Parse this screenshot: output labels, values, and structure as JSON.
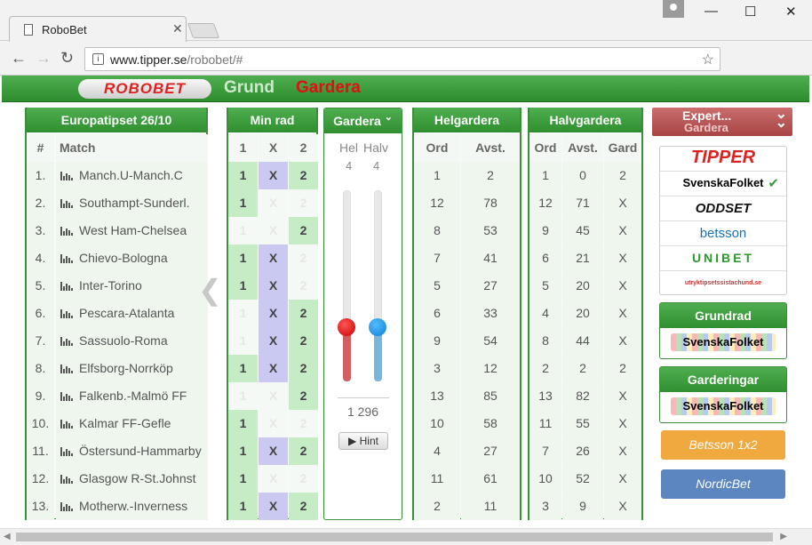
{
  "browser": {
    "tab_title": "RoboBet",
    "url_host": "www.tipper.se",
    "url_path": "/robobet/#",
    "omni_icon_label": "i"
  },
  "site": {
    "logo": "ROBOBET",
    "nav": [
      {
        "label": "Grund"
      },
      {
        "label": "Gardera"
      }
    ],
    "active_nav": "Gardera"
  },
  "coupon": {
    "title": "Europatipset 26/10",
    "col_num": "#",
    "col_match": "Match",
    "matches": [
      {
        "n": "1.",
        "name": "Manch.U-Manch.C"
      },
      {
        "n": "2.",
        "name": "Southampt-Sunderl."
      },
      {
        "n": "3.",
        "name": "West Ham-Chelsea"
      },
      {
        "n": "4.",
        "name": "Chievo-Bologna"
      },
      {
        "n": "5.",
        "name": "Inter-Torino"
      },
      {
        "n": "6.",
        "name": "Pescara-Atalanta"
      },
      {
        "n": "7.",
        "name": "Sassuolo-Roma"
      },
      {
        "n": "8.",
        "name": "Elfsborg-Norrköp"
      },
      {
        "n": "9.",
        "name": "Falkenb.-Malmö FF"
      },
      {
        "n": "10.",
        "name": "Kalmar FF-Gefle"
      },
      {
        "n": "11.",
        "name": "Östersund-Hammarby"
      },
      {
        "n": "12.",
        "name": "Glasgow R-St.Johnst"
      },
      {
        "n": "13.",
        "name": "Motherw.-Inverness"
      }
    ]
  },
  "minrad": {
    "title": "Min rad",
    "cols": [
      "1",
      "X",
      "2"
    ],
    "picks": [
      [
        1,
        1,
        1
      ],
      [
        1,
        0,
        0
      ],
      [
        0,
        0,
        1
      ],
      [
        1,
        1,
        0
      ],
      [
        1,
        1,
        0
      ],
      [
        0,
        1,
        1
      ],
      [
        0,
        1,
        1
      ],
      [
        1,
        1,
        1
      ],
      [
        0,
        0,
        1
      ],
      [
        1,
        0,
        0
      ],
      [
        1,
        1,
        1
      ],
      [
        1,
        0,
        0
      ],
      [
        1,
        1,
        1
      ]
    ]
  },
  "gardera": {
    "title": "Gardera",
    "hel_label": "Hel",
    "halv_label": "Halv",
    "hel_value": "4",
    "halv_value": "4",
    "hel_level": 0.28,
    "halv_level": 0.28,
    "rows_count": "1 296",
    "hint_label": "Hint",
    "hint_icon": "▶"
  },
  "helgardera": {
    "title": "Helgardera",
    "col_ord": "Ord",
    "col_avst": "Avst.",
    "rows": [
      {
        "ord": "1",
        "avst": "2"
      },
      {
        "ord": "12",
        "avst": "78"
      },
      {
        "ord": "8",
        "avst": "53"
      },
      {
        "ord": "7",
        "avst": "41"
      },
      {
        "ord": "5",
        "avst": "27"
      },
      {
        "ord": "6",
        "avst": "33"
      },
      {
        "ord": "9",
        "avst": "54"
      },
      {
        "ord": "3",
        "avst": "12"
      },
      {
        "ord": "13",
        "avst": "85"
      },
      {
        "ord": "10",
        "avst": "58"
      },
      {
        "ord": "4",
        "avst": "27"
      },
      {
        "ord": "11",
        "avst": "61"
      },
      {
        "ord": "2",
        "avst": "11"
      }
    ]
  },
  "halvgardera": {
    "title": "Halvgardera",
    "col_ord": "Ord",
    "col_avst": "Avst.",
    "col_gard": "Gard",
    "rows": [
      {
        "ord": "1",
        "avst": "0",
        "gard": "2"
      },
      {
        "ord": "12",
        "avst": "71",
        "gard": "X"
      },
      {
        "ord": "9",
        "avst": "45",
        "gard": "X"
      },
      {
        "ord": "6",
        "avst": "21",
        "gard": "X"
      },
      {
        "ord": "5",
        "avst": "20",
        "gard": "X"
      },
      {
        "ord": "4",
        "avst": "20",
        "gard": "X"
      },
      {
        "ord": "8",
        "avst": "44",
        "gard": "X"
      },
      {
        "ord": "2",
        "avst": "2",
        "gard": "2"
      },
      {
        "ord": "13",
        "avst": "82",
        "gard": "X"
      },
      {
        "ord": "11",
        "avst": "55",
        "gard": "X"
      },
      {
        "ord": "7",
        "avst": "26",
        "gard": "X"
      },
      {
        "ord": "10",
        "avst": "52",
        "gard": "X"
      },
      {
        "ord": "3",
        "avst": "9",
        "gard": "X"
      }
    ]
  },
  "sidebar": {
    "expert_line1": "Expert...",
    "expert_line2": "Gardera",
    "brands": [
      {
        "name": "TIPPER",
        "color": "#d22"
      },
      {
        "name": "SvenskaFolket",
        "color": "#000"
      },
      {
        "name": "ODDSET",
        "color": "#111"
      },
      {
        "name": "betsson",
        "color": "#1a6fb5"
      },
      {
        "name": "UNIBET",
        "color": "#2b9a2b"
      },
      {
        "name": "utryktipsetssistachund.se",
        "color": "#c33"
      }
    ],
    "check_icon": "✔",
    "grundrad_title": "Grundrad",
    "grundrad_brand": "SvenskaFolket",
    "garderingar_title": "Garderingar",
    "garderingar_brand": "SvenskaFolket",
    "betsson_btn": "Betsson 1x2",
    "nordicbet_btn": "NordicBet",
    "betsson_color": "#f0a93e",
    "nordicbet_color": "#5b86c0"
  },
  "prev_arrow": "❮"
}
